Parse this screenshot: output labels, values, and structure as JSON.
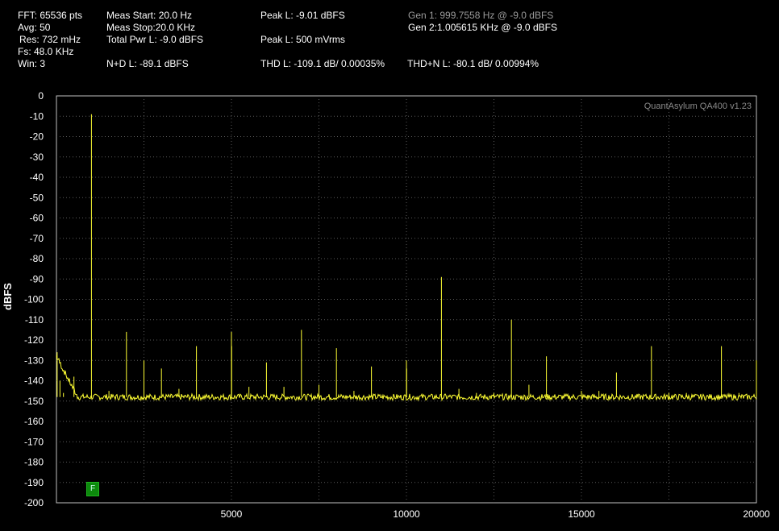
{
  "header": {
    "fft": "FFT: 65536 pts",
    "avg": "Avg: 50",
    "res": "Res: 732 mHz",
    "fs": "Fs: 48.0 KHz",
    "win": "Win: 3",
    "meas_start": "Meas Start: 20.0 Hz",
    "meas_stop": "Meas Stop:20.0 KHz",
    "total_pwr": "Total Pwr L: -9.0 dBFS",
    "nd": "N+D L: -89.1 dBFS",
    "peak_dbfs": "Peak L: -9.01 dBFS",
    "peak_vrms": "Peak L: 500 mVrms",
    "thd": "THD L: -109.1 dB/ 0.00035%",
    "thdn": "THD+N L: -80.1 dB/ 0.00994%",
    "gen1": "Gen 1: 999.7558 Hz @ -9.0  dBFS",
    "gen2": "Gen 2:1.005615 KHz @ -9.0  dBFS"
  },
  "watermark": "QuantAsylum QA400 v1.23",
  "badge": "F",
  "colors": {
    "trace": "#ffff33",
    "grid": "#5a5a5a",
    "axis": "#ffffff"
  },
  "chart_data": {
    "type": "line",
    "ylabel": "dBFS",
    "xlabel": "",
    "xlim": [
      0,
      20000
    ],
    "ylim": [
      -200,
      0
    ],
    "x_ticks": [
      5000,
      10000,
      15000,
      20000
    ],
    "y_ticks": [
      0,
      -10,
      -20,
      -30,
      -40,
      -50,
      -60,
      -70,
      -80,
      -90,
      -100,
      -110,
      -120,
      -130,
      -140,
      -150,
      -160,
      -170,
      -180,
      -190,
      -200
    ],
    "grid": true,
    "noise_floor_dbfs": -148,
    "series": [
      {
        "x": [
          20,
          100,
          200,
          400,
          500,
          1000,
          1500,
          2000,
          2500,
          3000,
          3500,
          4000,
          5000,
          5006,
          5500,
          6000,
          6500,
          7000,
          7500,
          8000,
          8500,
          9000,
          10000,
          10006,
          11000,
          11500,
          12000,
          12500,
          13000,
          13500,
          14000,
          15000,
          15500,
          16000,
          17000,
          17500,
          18000,
          19000,
          19500,
          20000
        ],
        "y": [
          -126,
          -140,
          -146,
          -148,
          -138,
          -9,
          -145,
          -116,
          -130,
          -134,
          -144,
          -123,
          -116,
          -123,
          -143,
          -131,
          -143,
          -115,
          -142,
          -124,
          -145,
          -133,
          -130,
          -134,
          -89,
          -144,
          -146,
          -146,
          -110,
          -142,
          -128,
          -145,
          -145,
          -136,
          -123,
          -146,
          -146,
          -123,
          -146,
          -130
        ]
      }
    ]
  }
}
